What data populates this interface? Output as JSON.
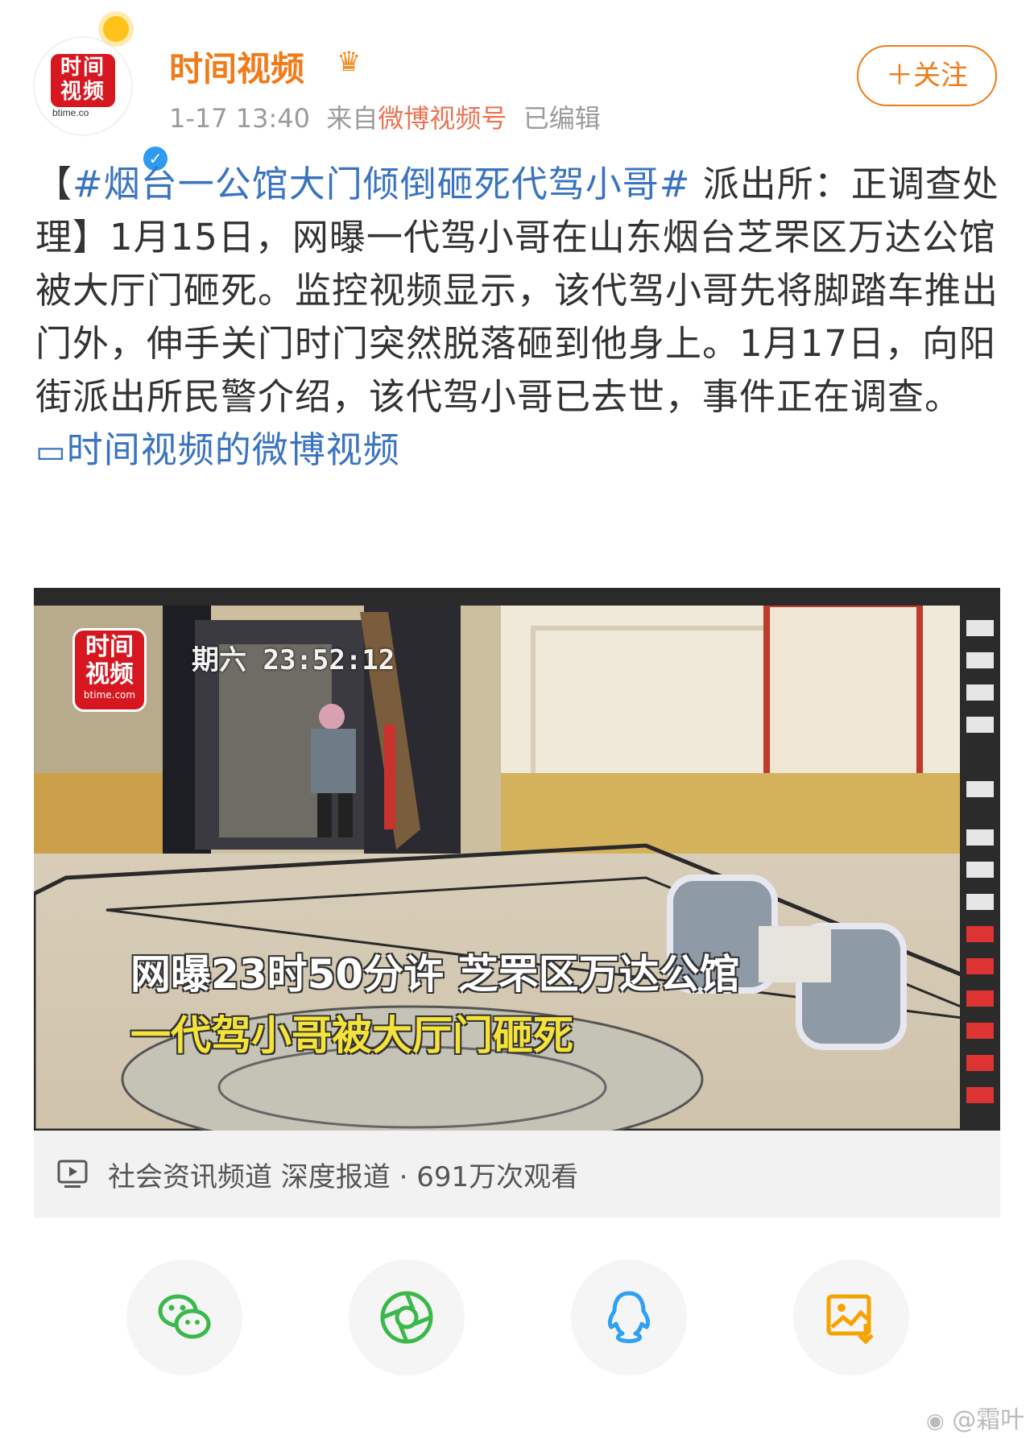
{
  "header": {
    "avatar_text": [
      "时间",
      "视频"
    ],
    "avatar_domain": "btime.co",
    "name": "时间视频",
    "date": "1-17 13:40",
    "from_prefix": "来自",
    "source": "微博视频号",
    "edited": "已编辑",
    "follow_label": "＋关注"
  },
  "post": {
    "bracket_open": "【",
    "hashtag": "#烟台一公馆大门倾倒砸死代驾小哥#",
    "body": " 派出所：正调查处理】1月15日，网曝一代驾小哥在山东烟台芝罘区万达公馆被大厅门砸死。监控视频显示，该代驾小哥先将脚踏车推出门外，伸手关门时门突然脱落砸到他身上。1月17日，向阳街派出所民警介绍，该代驾小哥已去世，事件正在调查。 ",
    "link": "时间视频的微博视频"
  },
  "video": {
    "watermark": [
      "时间",
      "视频"
    ],
    "watermark_domain": "btime.com",
    "timestamp": "期六  23:52:12",
    "caption_line1": "网曝23时50分许 芝罘区万达公馆",
    "caption_line2": "一代驾小哥被大厅门砸死"
  },
  "video_bar": {
    "text": "社会资讯频道 深度报道 · 691万次观看"
  },
  "share": {
    "items": [
      "wechat-icon",
      "moments-icon",
      "qq-icon",
      "save-image-icon"
    ]
  },
  "footer": {
    "watermark": "@霜叶"
  },
  "colors": {
    "accent_orange": "#f07b18",
    "link_blue": "#3a74c0",
    "wechat_green": "#3bb84a",
    "qq_blue": "#2ea1f2",
    "save_orange": "#f5a300"
  }
}
